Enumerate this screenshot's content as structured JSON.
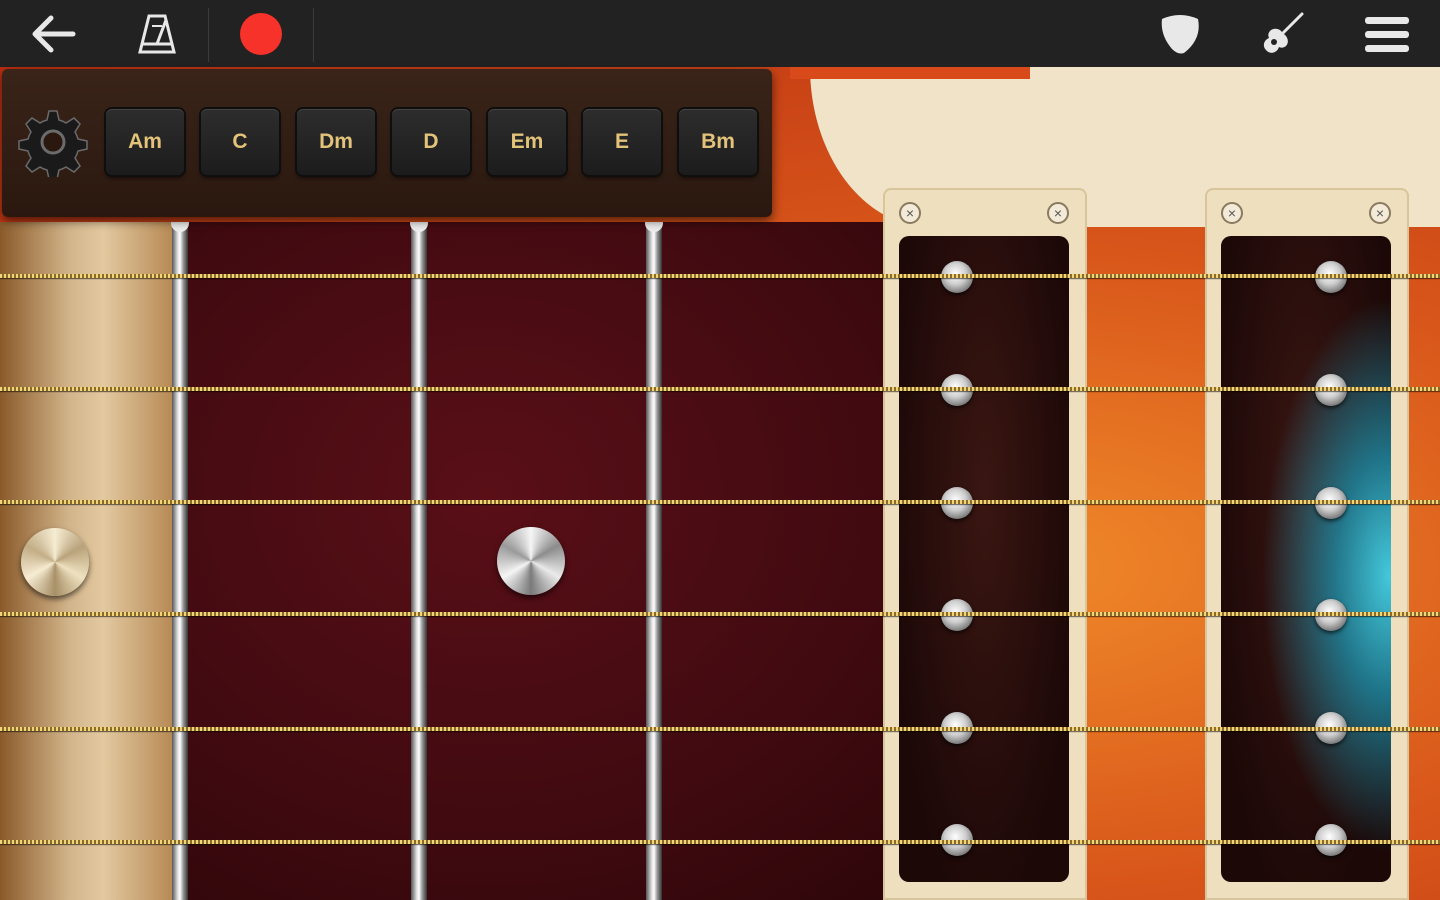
{
  "toolbar": {
    "back_icon": "back-arrow-icon",
    "metronome_icon": "metronome-icon",
    "record_icon": "record-icon",
    "pick_icon": "guitar-pick-icon",
    "guitar_icon": "guitar-icon",
    "menu_icon": "hamburger-menu-icon",
    "record_color": "#f6322a"
  },
  "chord_panel": {
    "settings_icon": "gear-icon",
    "chords": [
      "Am",
      "C",
      "Dm",
      "D",
      "Em",
      "E",
      "Bm"
    ]
  },
  "fretboard": {
    "string_count": 6,
    "fret_count": 3,
    "inlay_count": 2
  },
  "pickups": {
    "count": 2,
    "remove_icon": "close-icon",
    "active_pickup": 2,
    "active_glow_color": "#3cc8dc"
  }
}
